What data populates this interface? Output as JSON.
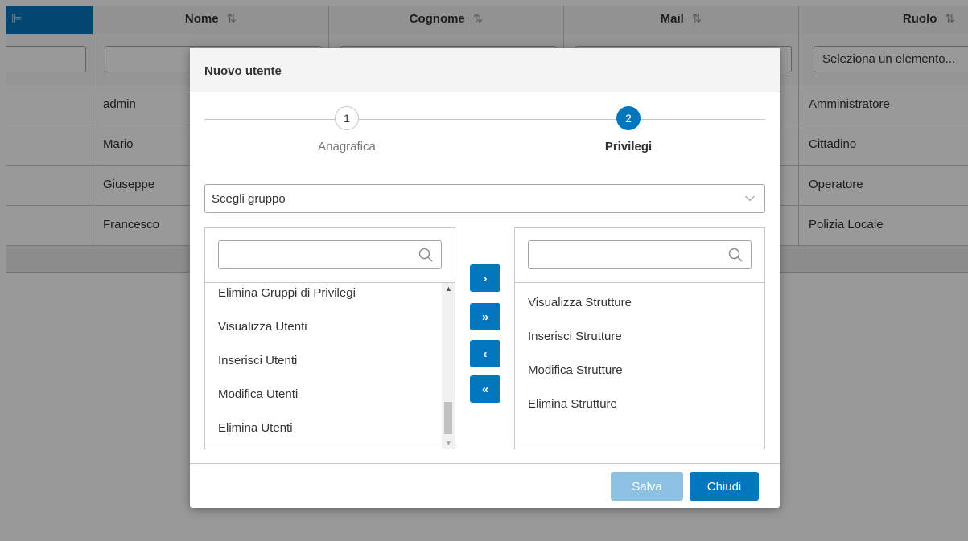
{
  "grid": {
    "columns": [
      {
        "label": "",
        "sort_icon": "sort-icon"
      },
      {
        "label": "Nome",
        "sort_icon": "sort-icon"
      },
      {
        "label": "Cognome",
        "sort_icon": "sort-icon"
      },
      {
        "label": "Mail",
        "sort_icon": "sort-icon"
      },
      {
        "label": "Ruolo",
        "sort_icon": "sort-icon"
      }
    ],
    "sort_glyph": "⇅",
    "header_icon_glyph": "⊫",
    "role_filter_placeholder": "Seleziona un elemento...",
    "rows": [
      {
        "nome": "admin",
        "ruolo": "Amministratore"
      },
      {
        "nome": "Mario",
        "ruolo": "Cittadino"
      },
      {
        "nome": "Giuseppe",
        "ruolo": "Operatore"
      },
      {
        "nome": "Francesco",
        "ruolo": "Polizia Locale"
      }
    ]
  },
  "dialog": {
    "title": "Nuovo utente",
    "steps": [
      {
        "number": "1",
        "label": "Anagrafica",
        "active": false
      },
      {
        "number": "2",
        "label": "Privilegi",
        "active": true
      }
    ],
    "group_select": {
      "value": "Scegli gruppo",
      "icon": "chevron-down-icon",
      "glyph": "⌵"
    },
    "source_list": {
      "search_value": "",
      "items": [
        "Elimina Gruppi di Privilegi",
        "Visualizza Utenti",
        "Inserisci Utenti",
        "Modifica Utenti",
        "Elimina Utenti"
      ]
    },
    "target_list": {
      "search_value": "",
      "items": [
        "Visualizza Strutture",
        "Inserisci Strutture",
        "Modifica Strutture",
        "Elimina Strutture"
      ]
    },
    "transfer_buttons": {
      "move_right": "›",
      "move_all_right": "»",
      "move_left": "‹",
      "move_all_left": "«"
    },
    "footer": {
      "save_label": "Salva",
      "close_label": "Chiudi"
    }
  },
  "colors": {
    "primary": "#0277bd",
    "overlay": "rgba(0,0,0,0.4)"
  }
}
